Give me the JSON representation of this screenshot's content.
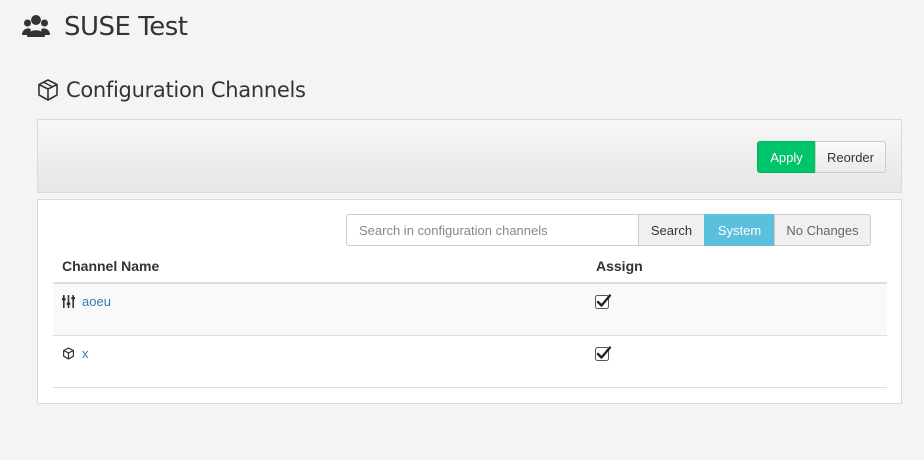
{
  "page": {
    "title": "SUSE Test",
    "icon": "users-icon"
  },
  "section": {
    "title": "Configuration Channels",
    "icon": "cube-icon"
  },
  "toolbar": {
    "apply_label": "Apply",
    "reorder_label": "Reorder"
  },
  "search": {
    "placeholder": "Search in configuration channels",
    "value": "",
    "search_label": "Search",
    "filter_system_label": "System",
    "filter_nochanges_label": "No Changes",
    "active_filter": "System"
  },
  "table": {
    "columns": [
      "Channel Name",
      "Assign"
    ],
    "rows": [
      {
        "icon": "sliders-icon",
        "name": "aoeu",
        "assigned": true
      },
      {
        "icon": "cube-icon",
        "name": "x",
        "assigned": true
      }
    ]
  },
  "colors": {
    "apply": "#00c46a",
    "system_filter": "#5bc0de",
    "link": "#337ab7",
    "background": "#f4f4f4"
  }
}
